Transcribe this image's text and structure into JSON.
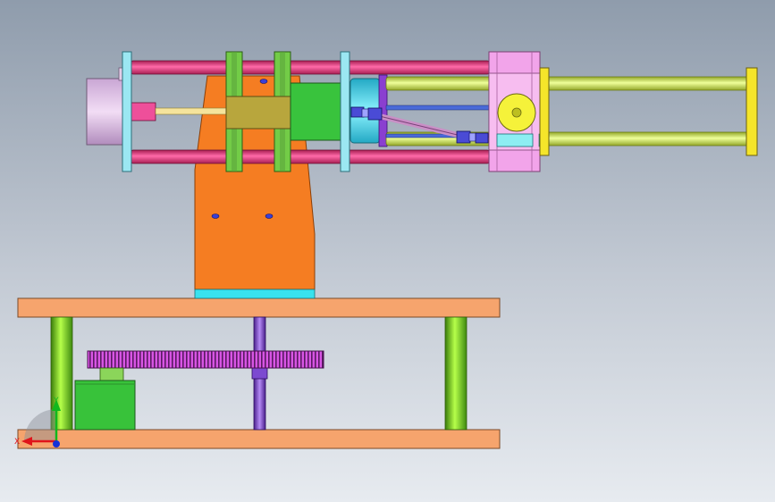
{
  "view": {
    "background_top": "#8f9cac",
    "background_bottom": "#e7ebf0"
  },
  "triad": {
    "x_label": "X",
    "y_label": "Y",
    "x_color": "#e0141b",
    "y_color": "#11b81c",
    "z_color": "#1431d9"
  },
  "palette": {
    "base_plate": "#f6a46d",
    "column": "#8ee21b",
    "vertical_shaft": "#8a50d8",
    "gear": "#d855e4",
    "motor": "#38c23a",
    "stand": "#f57d22",
    "stand_foot": "#38e2ee",
    "guide_rod": "#e6377a",
    "plate_blue": "#9be7f2",
    "plate_green": "#73cc47",
    "carriage": "#b8a63d",
    "cylinder_body": "#39c33d",
    "drum": "#46d8ee",
    "link_rod": "#c98fc6",
    "block_pink": "#f2a4ea",
    "yellow_rod": "#d9f46b",
    "yellow_end": "#f5e52a",
    "joint_blue": "#4a4bd6"
  }
}
